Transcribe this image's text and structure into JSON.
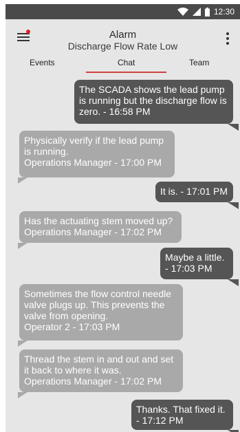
{
  "status_bar": {
    "time": "12:30",
    "icons": [
      "wifi-icon",
      "signal-icon",
      "battery-icon"
    ]
  },
  "header": {
    "title": "Alarm",
    "subtitle": "Discharge Flow Rate Low"
  },
  "tabs": [
    {
      "label": "Events"
    },
    {
      "label": "Chat",
      "active": true
    },
    {
      "label": "Team"
    }
  ],
  "messages": [
    {
      "side": "right",
      "text": "The SCADA shows the lead pump is running but the discharge flow is zero.",
      "sender": "",
      "time": "16:58 PM"
    },
    {
      "side": "left",
      "text": "Physically verify if the lead pump is running.",
      "sender": "Operations Manager",
      "time": "17:00 PM"
    },
    {
      "side": "right",
      "text": "It is.",
      "sender": "",
      "time": "17:01 PM"
    },
    {
      "side": "left",
      "text": "Has the actuating stem moved up?",
      "sender": "Operations Manager",
      "time": "17:02 PM"
    },
    {
      "side": "right",
      "text": "Maybe a little.",
      "sender": "",
      "time": "17:03 PM"
    },
    {
      "side": "left",
      "text": "Sometimes the flow control needle valve plugs up. This prevents the valve from opening.",
      "sender": "Operator 2",
      "time": "17:03 PM"
    },
    {
      "side": "left",
      "text": "Thread the stem in and out and set it back to where it was.",
      "sender": "Operations Manager",
      "time": "17:02 PM"
    },
    {
      "side": "right",
      "text": "Thanks. That fixed it.",
      "sender": "",
      "time": "17:12 PM"
    }
  ],
  "colors": {
    "active_tab_underline": "#d04040",
    "notification_dot": "#e02020",
    "outgoing_bubble": "#555555",
    "incoming_bubble": "#a9a9a9"
  }
}
